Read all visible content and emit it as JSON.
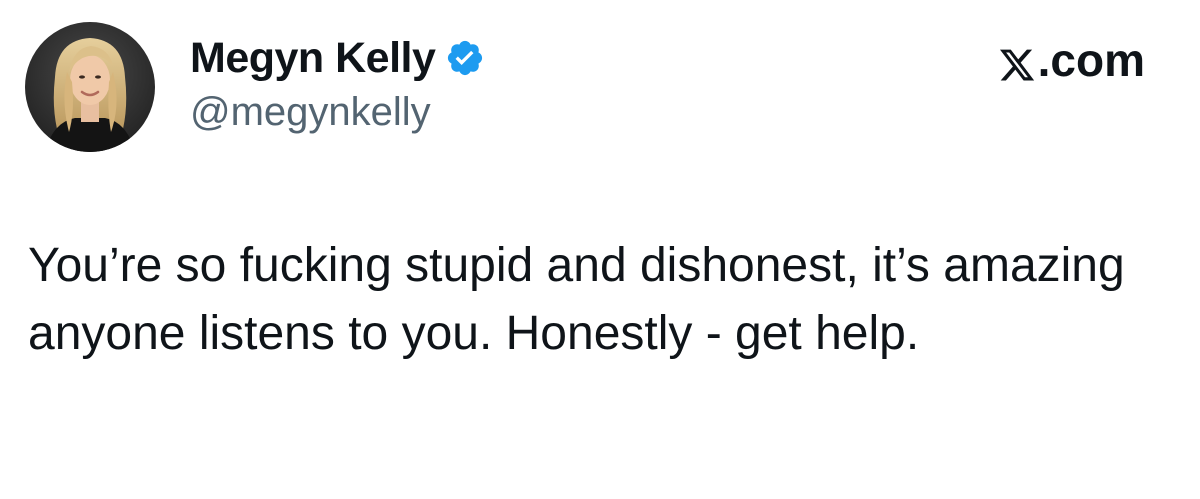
{
  "author": {
    "display_name": "Megyn Kelly",
    "handle": "@megynkelly",
    "verified": true,
    "avatar_icon": "profile-photo"
  },
  "brand": {
    "logo_icon": "x-logo-icon",
    "suffix": ".com"
  },
  "tweet": {
    "text": "You’re so fucking stupid and dishonest, it’s amazing anyone listens to you. Honestly - get help."
  },
  "colors": {
    "text_primary": "#0f1419",
    "text_secondary": "#536471",
    "verified_blue": "#1d9bf0",
    "background": "#ffffff"
  }
}
